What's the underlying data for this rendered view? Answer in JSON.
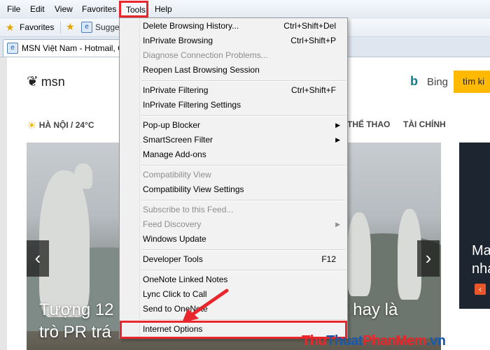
{
  "menubar": {
    "items": [
      "File",
      "Edit",
      "View",
      "Favorites",
      "Tools",
      "Help"
    ]
  },
  "favorites_bar": {
    "favorites_label": "Favorites",
    "suggested_label": "Sugge"
  },
  "tab": {
    "title": "MSN Việt Nam - Hotmail, O"
  },
  "page": {
    "logo_text": "msn",
    "bing_label": "Bing",
    "search_button": "tìm ki",
    "weather": "HÀ NỘI / 24°C",
    "nav_sports": "THỂ THAO",
    "nav_finance": "TÀI CHÍNH",
    "hero_line1": "Tượng 12",
    "hero_line1_right": "' hay là",
    "hero_line2": "trò PR trá",
    "side_card_text": "Ma\nnha"
  },
  "tools_menu": {
    "items": [
      {
        "label": "Delete Browsing History...",
        "shortcut": "Ctrl+Shift+Del",
        "disabled": false
      },
      {
        "label": "InPrivate Browsing",
        "shortcut": "Ctrl+Shift+P",
        "disabled": false
      },
      {
        "label": "Diagnose Connection Problems...",
        "shortcut": "",
        "disabled": true
      },
      {
        "label": "Reopen Last Browsing Session",
        "shortcut": "",
        "disabled": false
      },
      {
        "label": "InPrivate Filtering",
        "shortcut": "Ctrl+Shift+F",
        "disabled": false
      },
      {
        "label": "InPrivate Filtering Settings",
        "shortcut": "",
        "disabled": false
      },
      {
        "label": "Pop-up Blocker",
        "shortcut": "",
        "disabled": false
      },
      {
        "label": "SmartScreen Filter",
        "shortcut": "",
        "disabled": false
      },
      {
        "label": "Manage Add-ons",
        "shortcut": "",
        "disabled": false
      },
      {
        "label": "Compatibility View",
        "shortcut": "",
        "disabled": true
      },
      {
        "label": "Compatibility View Settings",
        "shortcut": "",
        "disabled": false
      },
      {
        "label": "Subscribe to this Feed...",
        "shortcut": "",
        "disabled": true
      },
      {
        "label": "Feed Discovery",
        "shortcut": "",
        "disabled": true
      },
      {
        "label": "Windows Update",
        "shortcut": "",
        "disabled": false
      },
      {
        "label": "Developer Tools",
        "shortcut": "F12",
        "disabled": false
      },
      {
        "label": "OneNote Linked Notes",
        "shortcut": "",
        "disabled": false
      },
      {
        "label": "Lync Click to Call",
        "shortcut": "",
        "disabled": false
      },
      {
        "label": "Send to OneNote",
        "shortcut": "",
        "disabled": false
      },
      {
        "label": "Internet Options",
        "shortcut": "",
        "disabled": false
      }
    ]
  },
  "watermark": {
    "part1": "Thu",
    "part2": "Thuat",
    "part3": "PhanMem",
    "part4": ".vn"
  },
  "colors": {
    "highlight_red": "#e8262b",
    "watermark_red": "#e8262b",
    "watermark_blue": "#1a5aa8",
    "bing_accent": "#ffb900"
  }
}
